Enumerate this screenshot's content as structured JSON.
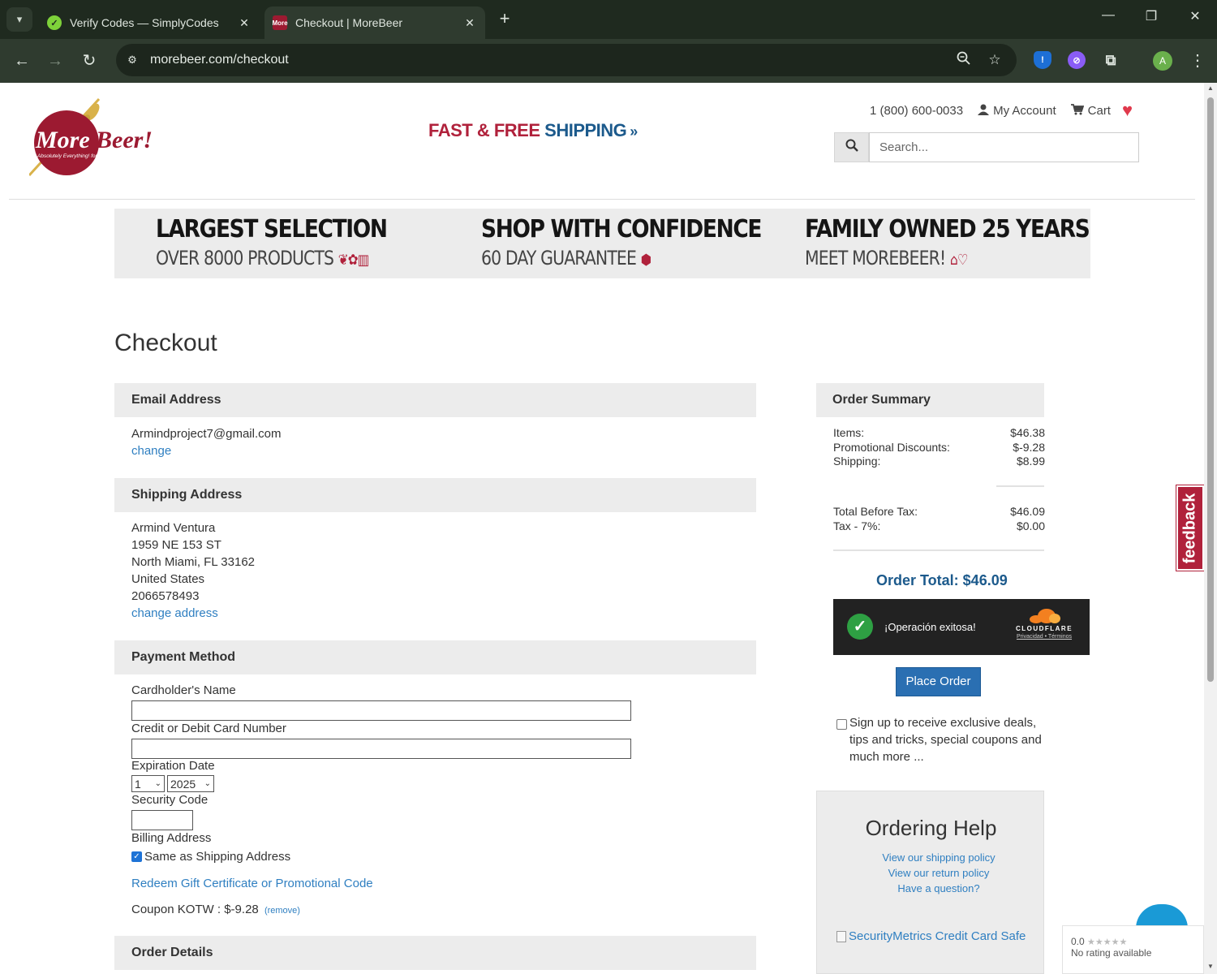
{
  "browser": {
    "tabs": [
      {
        "title": "Verify Codes — SimplyCodes",
        "favicon": "simplycodes-icon",
        "active": false
      },
      {
        "title": "Checkout | MoreBeer",
        "favicon": "morebeer-icon",
        "active": true
      }
    ],
    "url": "morebeer.com/checkout",
    "profile_initial": "A"
  },
  "header": {
    "logo_text": "MoreBeer!",
    "logo_tagline": "Absolutely Everything! for Beer Making",
    "promo_part1": "FAST & FREE",
    "promo_part2": "SHIPPING",
    "phone": "1 (800) 600-0033",
    "my_account": "My Account",
    "cart": "Cart",
    "search_placeholder": "Search..."
  },
  "banner": [
    {
      "title": "LARGEST SELECTION",
      "subtitle": "OVER 8000 PRODUCTS"
    },
    {
      "title": "SHOP WITH CONFIDENCE",
      "subtitle": "60 DAY GUARANTEE"
    },
    {
      "title": "FAMILY OWNED 25 YEARS",
      "subtitle": "MEET MOREBEER!"
    }
  ],
  "checkout": {
    "title": "Checkout",
    "email_section": "Email Address",
    "email": "Armindproject7@gmail.com",
    "change": "change",
    "shipping_section": "Shipping Address",
    "address_lines": [
      "Armind Ventura",
      "1959 NE 153 ST",
      "North Miami, FL 33162",
      "United States",
      "2066578493"
    ],
    "change_address": "change address",
    "payment_section": "Payment Method",
    "cardholder_label": "Cardholder's Name",
    "card_number_label": "Credit or Debit Card Number",
    "expiration_label": "Expiration Date",
    "exp_month": "1",
    "exp_year": "2025",
    "security_label": "Security Code",
    "billing_label": "Billing Address",
    "same_as_shipping": "Same as Shipping Address",
    "same_as_shipping_checked": true,
    "redeem_link": "Redeem Gift Certificate or Promotional Code",
    "coupon_label": "Coupon KOTW :",
    "coupon_value": "$-9.28",
    "coupon_remove": "(remove)",
    "order_details_section": "Order Details"
  },
  "summary": {
    "title": "Order Summary",
    "items_label": "Items:",
    "items": "$46.38",
    "promo_label": "Promotional Discounts:",
    "promo": "$-9.28",
    "shipping_label": "Shipping:",
    "shipping": "$8.99",
    "before_tax_label": "Total Before Tax:",
    "before_tax": "$46.09",
    "tax_label": "Tax - 7%:",
    "tax": "$0.00",
    "order_total": "Order Total: $46.09",
    "captcha_message": "¡Operación exitosa!",
    "captcha_brand": "CLOUDFLARE",
    "captcha_legal": "Privacidad • Términos",
    "place_order": "Place Order",
    "signup_text": "Sign up to receive exclusive deals, tips and tricks, special coupons and much more ...",
    "signup_checked": false
  },
  "help": {
    "title": "Ordering Help",
    "links": [
      "View our shipping policy",
      "View our return policy",
      "Have a question?"
    ],
    "security_image_alt": "SecurityMetrics Credit Card Safe"
  },
  "widgets": {
    "feedback": "feedback",
    "rating_score": "0.0",
    "rating_text": "No rating available"
  },
  "colors": {
    "brand_red": "#b0213b",
    "brand_blue": "#1c5a8c",
    "link": "#2f7fc1",
    "button": "#2a6fb2"
  }
}
